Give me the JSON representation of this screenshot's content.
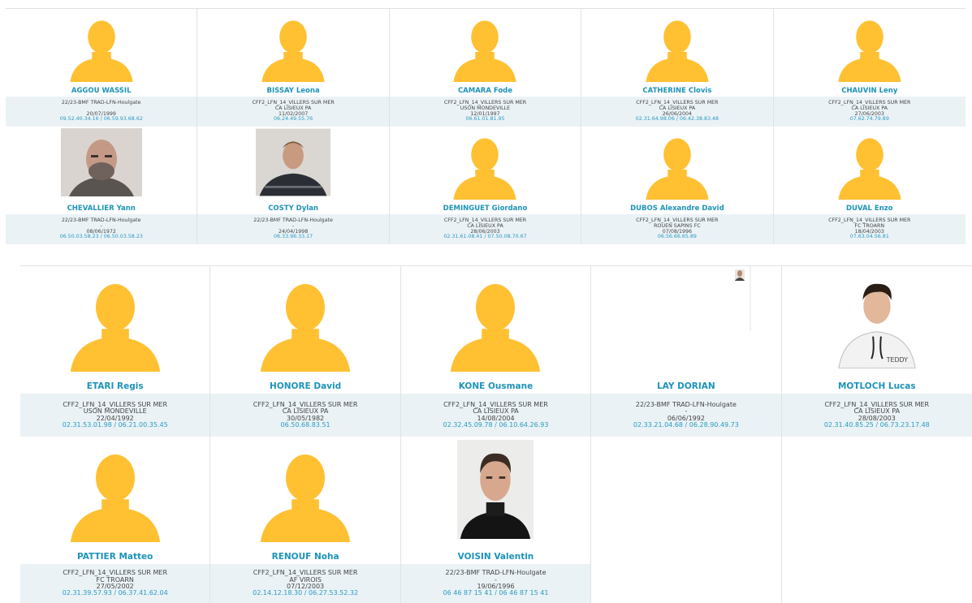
{
  "colors": {
    "name": "#1d93b8",
    "phone": "#2a9ac0",
    "info_bg": "#eaf2f6",
    "avatar": "#ffc032"
  },
  "top_players": [
    {
      "name": "AGGOU WASSIL",
      "team": "22/23-BMF TRAD-LFN-Houlgate",
      "club": "",
      "dob": "20/07/1999",
      "phones": "09.52.40.34.16 / 06.59.93.68.62",
      "photo": "silhouette"
    },
    {
      "name": "BISSAY Leona",
      "team": "CFF2_LFN_14_VILLERS SUR MER",
      "club": "CA LISIEUX PA",
      "dob": "11/02/2007",
      "phones": "06.24.49.55.76",
      "photo": "silhouette"
    },
    {
      "name": "CAMARA Fode",
      "team": "CFF2_LFN_14_VILLERS SUR MER",
      "club": "USON MONDEVILLE",
      "dob": "12/01/1997",
      "phones": "06.61.01.81.95",
      "photo": "silhouette"
    },
    {
      "name": "CATHERINE Clovis",
      "team": "CFF2_LFN_14_VILLERS SUR MER",
      "club": "CA LISIEUX PA",
      "dob": "26/06/2004",
      "phones": "02.31.64.98.06 / 06.42.38.83.48",
      "photo": "silhouette"
    },
    {
      "name": "CHAUVIN Leny",
      "team": "CFF2_LFN_14_VILLERS SUR MER",
      "club": "CA LISIEUX PA",
      "dob": "27/06/2003",
      "phones": "07.62.74.79.89",
      "photo": "silhouette"
    },
    {
      "name": "CHEVALLIER Yann",
      "team": "22/23-BMF TRAD-LFN-Houlgate",
      "club": "-",
      "dob": "08/06/1972",
      "phones": "06.50.03.58.23 / 06.50.03.58.23",
      "photo": "portrait-bald"
    },
    {
      "name": "COSTY Dylan",
      "team": "22/23-BMF TRAD-LFN-Houlgate",
      "club": "-",
      "dob": "24/04/1998",
      "phones": "06.33.96.33.17",
      "photo": "portrait-dark"
    },
    {
      "name": "DEMINGUET Giordano",
      "team": "CFF2_LFN_14_VILLERS SUR MER",
      "club": "CA LISIEUX PA",
      "dob": "28/06/2003",
      "phones": "02.31.61.08.41 / 07.50.08.70.67",
      "photo": "silhouette"
    },
    {
      "name": "DUBOS Alexandre David",
      "team": "CFF2_LFN_14_VILLERS SUR MER",
      "club": "ROUEN SAPINS FC",
      "dob": "07/08/1996",
      "phones": "06.56.66.65.89",
      "photo": "silhouette"
    },
    {
      "name": "DUVAL Enzo",
      "team": "CFF2_LFN_14_VILLERS SUR MER",
      "club": "FC TROARN",
      "dob": "18/04/2003",
      "phones": "07.63.04.56.81",
      "photo": "silhouette"
    }
  ],
  "bottom_players": [
    {
      "name": "ETARI Regis",
      "team": "CFF2_LFN_14_VILLERS SUR MER",
      "club": "USON MONDEVILLE",
      "dob": "22/04/1992",
      "phones": "02.31.53.01.98 / 06.21.00.35.45",
      "photo": "silhouette"
    },
    {
      "name": "HONORE David",
      "team": "CFF2_LFN_14_VILLERS SUR MER",
      "club": "CA LISIEUX PA",
      "dob": "30/05/1982",
      "phones": "06.50.68.83.51",
      "photo": "silhouette"
    },
    {
      "name": "KONE Ousmane",
      "team": "CFF2_LFN_14_VILLERS SUR MER",
      "club": "CA LISIEUX PA",
      "dob": "14/08/2004",
      "phones": "02.32.45.09.78 / 06.10.64.26.93",
      "photo": "silhouette"
    },
    {
      "name": "LAY DORIAN",
      "team": "22/23-BMF TRAD-LFN-Houlgate",
      "club": "-",
      "dob": "06/06/1992",
      "phones": "02.33.21.04.68 / 06.28.90.49.73",
      "photo": "tiny"
    },
    {
      "name": "MOTLOCH Lucas",
      "team": "CFF2_LFN_14_VILLERS SUR MER",
      "club": "CA LISIEUX PA",
      "dob": "28/08/2003",
      "phones": "02.31.40.85.25 / 06.73.23.17.48",
      "photo": "portrait-hoodie"
    },
    {
      "name": "PATTIER Matteo",
      "team": "CFF2_LFN_14_VILLERS SUR MER",
      "club": "FC TROARN",
      "dob": "27/05/2002",
      "phones": "02.31.39.57.93 / 06.37.41.62.04",
      "photo": "silhouette"
    },
    {
      "name": "RENOUF Noha",
      "team": "CFF2_LFN_14_VILLERS SUR MER",
      "club": "AF VIROIS",
      "dob": "07/12/2003",
      "phones": "02.14.12.18.30 / 06.27.53.52.32",
      "photo": "silhouette"
    },
    {
      "name": "VOISIN Valentin",
      "team": "22/23-BMF TRAD-LFN-Houlgate",
      "club": "-",
      "dob": "19/06/1996",
      "phones": "06 46 87 15 41 / 06 46 87 15 41",
      "photo": "portrait-turtleneck"
    }
  ]
}
